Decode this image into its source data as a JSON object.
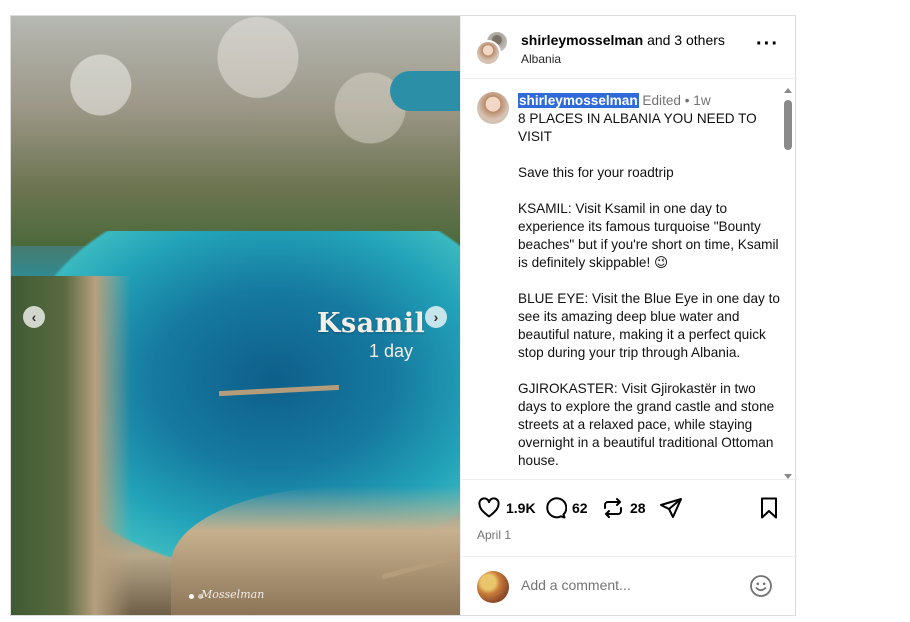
{
  "header": {
    "username": "shirleymosselman",
    "and_others": "and 3 others",
    "location": "Albania",
    "more_icon": "more-horizontal-icon"
  },
  "photo": {
    "overlay_title": "Ksamil",
    "overlay_subtitle": "1 day",
    "watermark": "Mosselman",
    "carousel_dots": 2,
    "active_dot": 1
  },
  "caption": {
    "username": "shirleymosselman",
    "edited": "Edited",
    "separator": "•",
    "time": "1w",
    "lead": "8 PLACES IN ALBANIA YOU NEED TO VISIT",
    "paragraphs": [
      "Save this for your roadtrip",
      "KSAMIL: Visit Ksamil in one day to experience its famous turquoise \"Bounty beaches\" but if you're short on time, Ksamil is definitely skippable! 😉",
      "BLUE EYE: Visit the Blue Eye in one day to see its amazing deep blue water and beautiful nature, making it a perfect quick stop during your trip through Albania.",
      "GJIROKASTER: Visit Gjirokastër in two days to explore the grand castle and stone streets at a relaxed pace, while staying overnight in a beautiful traditional Ottoman house."
    ]
  },
  "actions": {
    "likes": "1.9K",
    "comments": "62",
    "reposts": "28",
    "date": "April 1"
  },
  "comment_box": {
    "placeholder": "Add a comment..."
  },
  "colors": {
    "selection": "#2f6ad9",
    "muted_text": "#737373",
    "border": "#efefef"
  }
}
